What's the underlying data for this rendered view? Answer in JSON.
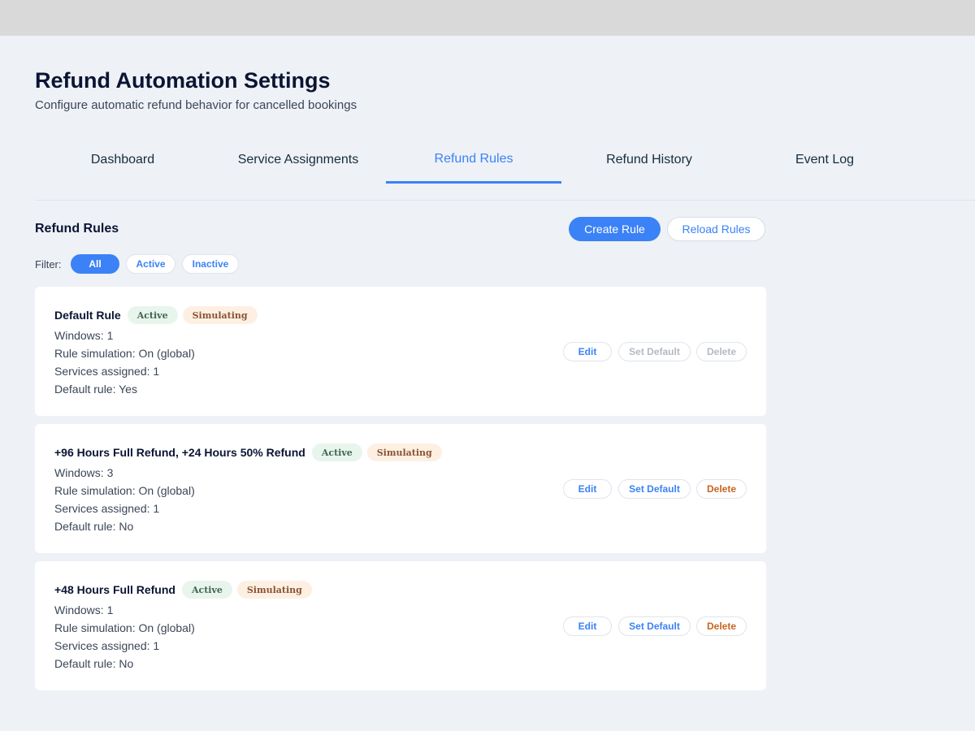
{
  "header": {
    "title": "Refund Automation Settings",
    "subtitle": "Configure automatic refund behavior for cancelled bookings"
  },
  "tabs": [
    {
      "label": "Dashboard",
      "active": false
    },
    {
      "label": "Service Assignments",
      "active": false
    },
    {
      "label": "Refund Rules",
      "active": true
    },
    {
      "label": "Refund History",
      "active": false
    },
    {
      "label": "Event Log",
      "active": false
    }
  ],
  "section": {
    "title": "Refund Rules",
    "create_label": "Create Rule",
    "reload_label": "Reload Rules"
  },
  "filter": {
    "label": "Filter:",
    "options": [
      "All",
      "Active",
      "Inactive"
    ],
    "selected": "All"
  },
  "rules": [
    {
      "name": "Default Rule",
      "status": "Active",
      "mode": "Simulating",
      "windows": "Windows: 1",
      "simulation": "Rule simulation: On (global)",
      "services": "Services assigned: 1",
      "default": "Default rule: Yes",
      "edit": "Edit",
      "set_default": "Set Default",
      "delete": "Delete"
    },
    {
      "name": "+96 Hours Full Refund, +24 Hours 50% Refund",
      "status": "Active",
      "mode": "Simulating",
      "windows": "Windows: 3",
      "simulation": "Rule simulation: On (global)",
      "services": "Services assigned: 1",
      "default": "Default rule: No",
      "edit": "Edit",
      "set_default": "Set Default",
      "delete": "Delete"
    },
    {
      "name": "+48 Hours Full Refund",
      "status": "Active",
      "mode": "Simulating",
      "windows": "Windows: 1",
      "simulation": "Rule simulation: On (global)",
      "services": "Services assigned: 1",
      "default": "Default rule: No",
      "edit": "Edit",
      "set_default": "Set Default",
      "delete": "Delete"
    }
  ],
  "colors": {
    "accent": "#3b82f6",
    "delete": "#c8641e",
    "active_badge_bg": "#e8f5ec",
    "simulating_badge_bg": "#fdf0e3",
    "page_bg": "#eef1f6"
  }
}
